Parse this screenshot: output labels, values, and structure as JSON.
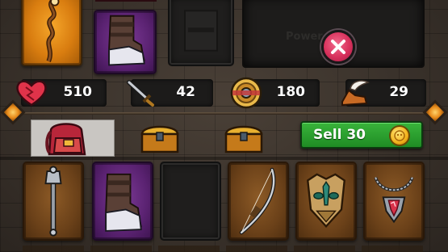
{
  "top_panel": {
    "power_label": "Power 34"
  },
  "stats": {
    "health": {
      "icon": "heart-icon",
      "value": "510"
    },
    "attack": {
      "icon": "sword-icon",
      "value": "42"
    },
    "defense": {
      "icon": "shield-icon",
      "value": "180"
    },
    "speed": {
      "icon": "winged-boot-icon",
      "value": "29"
    }
  },
  "tabs": [
    {
      "icon": "backpack-icon",
      "active": true
    },
    {
      "icon": "chest-icon",
      "active": false
    },
    {
      "icon": "chest-icon",
      "active": false
    }
  ],
  "sell": {
    "label": "Sell 30",
    "icon": "coin-icon"
  },
  "colors": {
    "rare": "#e88f18",
    "epic": "#6a2c84",
    "common": "#7a4b1e",
    "sell_green": "#2ea032",
    "close_pink": "#d8315c"
  },
  "equipped": [
    {
      "slot": "weapon",
      "item": "staff-icon",
      "rarity": "rare"
    },
    {
      "slot": "boots",
      "item": "boots-icon",
      "rarity": "epic"
    },
    {
      "slot": "armor",
      "item": "empty-armor-slot",
      "rarity": "empty"
    }
  ],
  "inventory": [
    {
      "item": "mace-icon",
      "rarity": "common"
    },
    {
      "item": "boots-icon",
      "rarity": "epic"
    },
    {
      "item": "empty-slot",
      "rarity": "empty"
    },
    {
      "item": "bow-icon",
      "rarity": "common"
    },
    {
      "item": "mask-icon",
      "rarity": "common"
    },
    {
      "item": "amulet-icon",
      "rarity": "common"
    }
  ]
}
